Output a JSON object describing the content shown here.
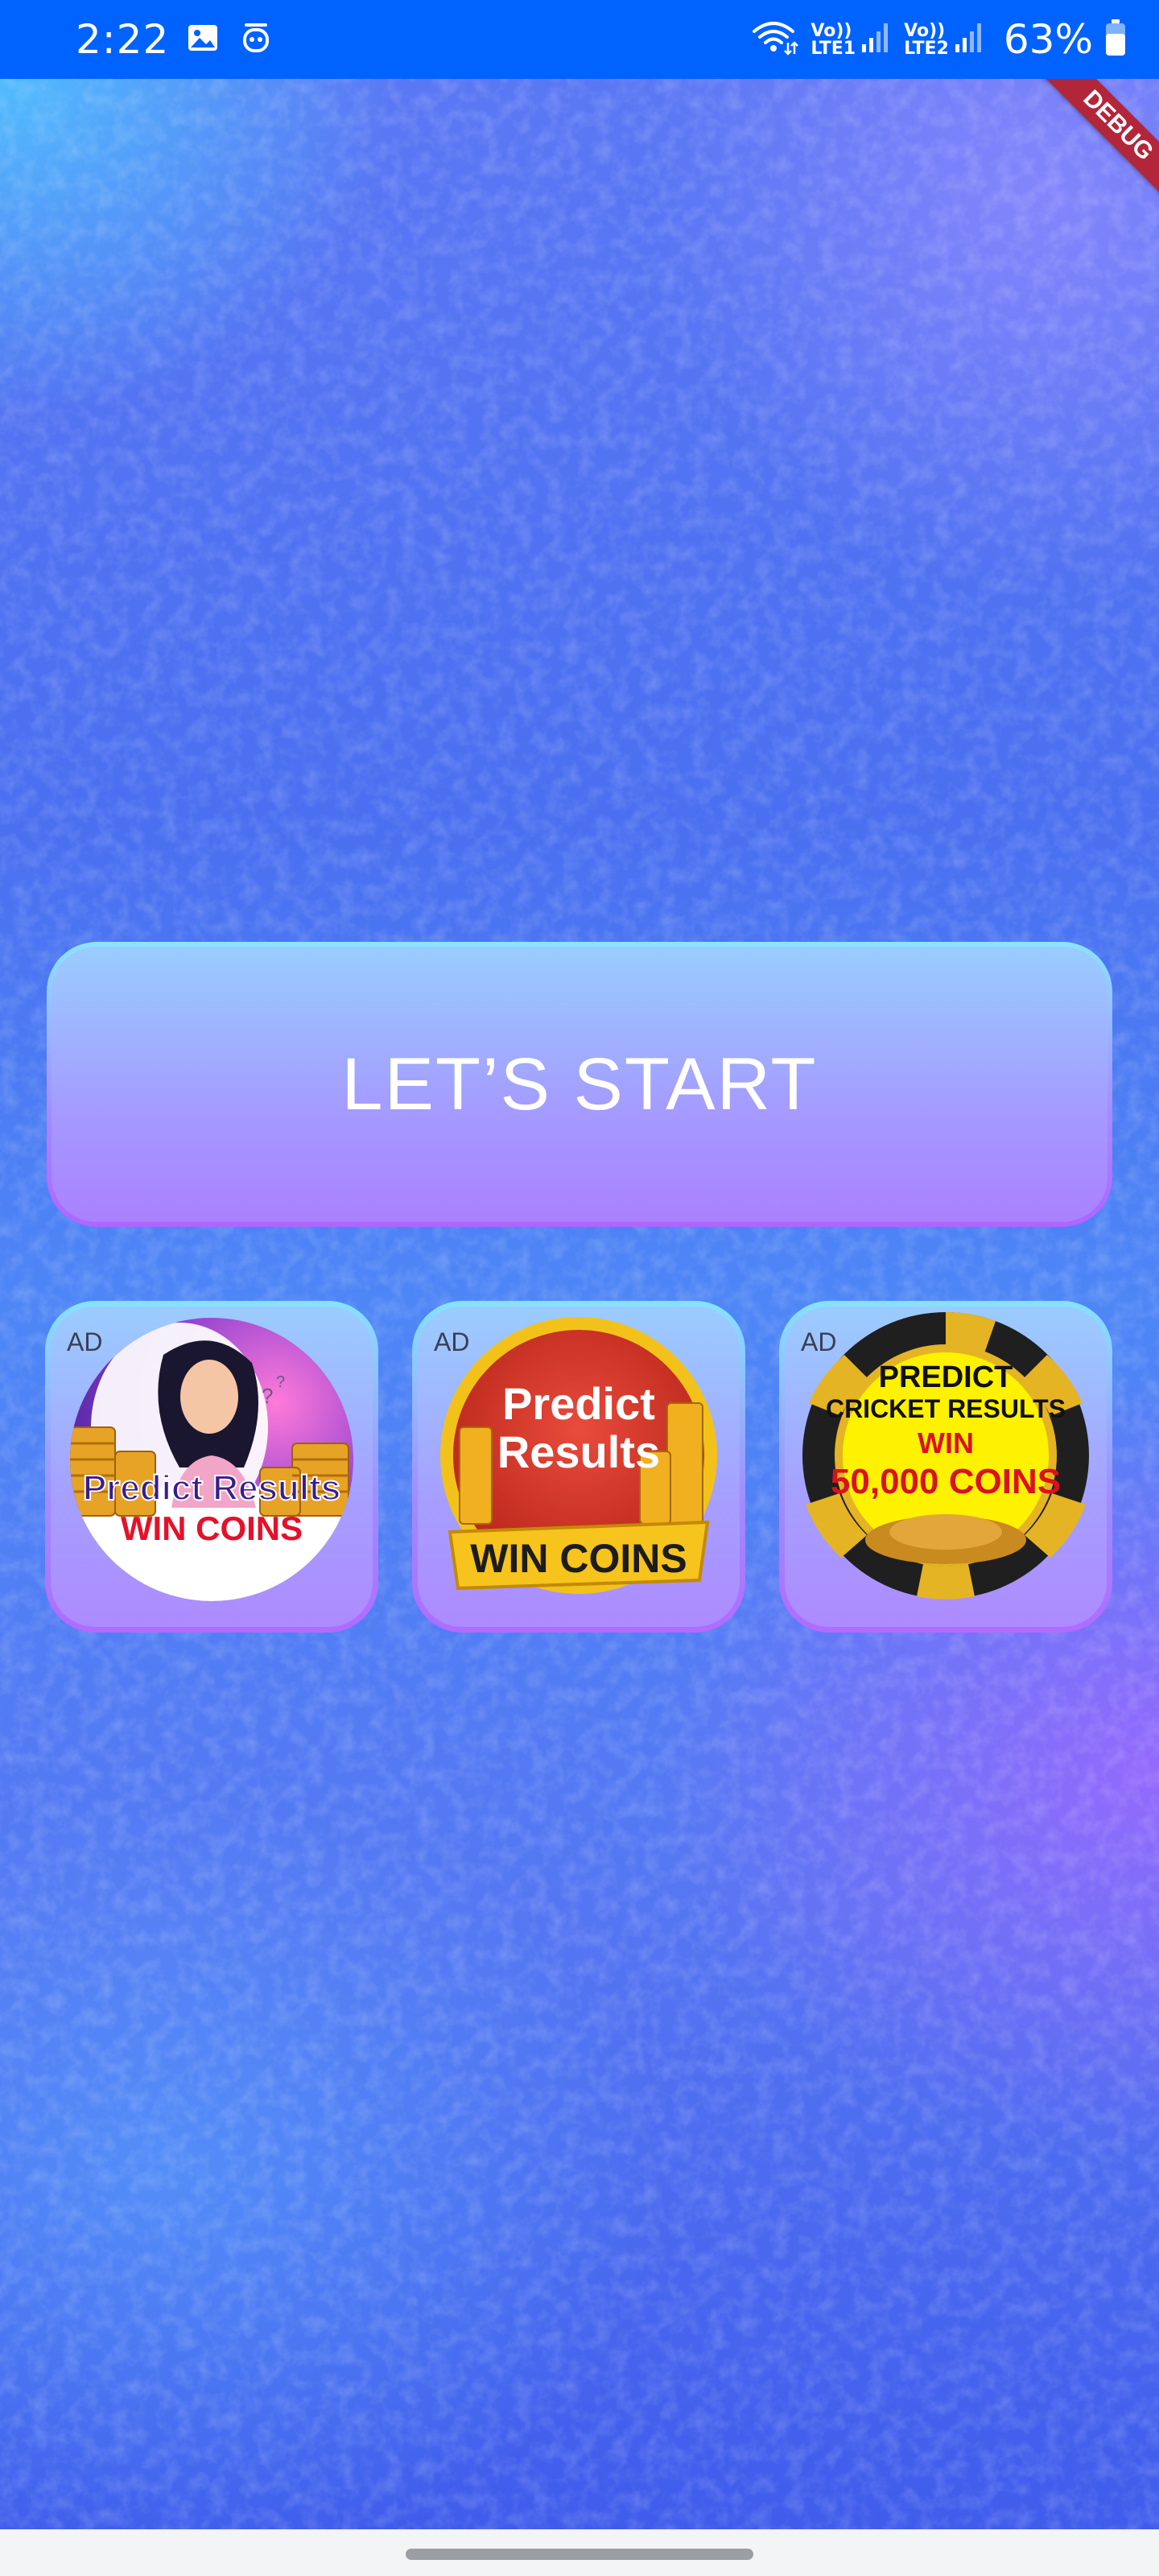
{
  "status_bar": {
    "time": "2:22",
    "sim1_top": "Vo))",
    "sim1_bottom": "LTE1",
    "sim2_top": "Vo))",
    "sim2_bottom": "LTE2",
    "battery_percent": "63%",
    "icons": [
      "gallery-icon",
      "assistant-icon",
      "wifi-icon",
      "signal-icon",
      "battery-icon"
    ]
  },
  "debug_banner": "DEBUG",
  "start_button": {
    "label": "LET’S START"
  },
  "ads": [
    {
      "label": "AD",
      "line1": "Predict Results",
      "line2": "WIN COINS"
    },
    {
      "label": "AD",
      "line1": "Predict",
      "line2": "Results",
      "line3": "WIN COINS"
    },
    {
      "label": "AD",
      "line1": "PREDICT",
      "line2": "CRICKET RESULTS",
      "line3": "WIN",
      "line4": "50,000 COINS"
    }
  ],
  "colors": {
    "status_bar": "#0062ff",
    "button_text": "#ffffff",
    "debug_ribbon": "#b3263a"
  }
}
